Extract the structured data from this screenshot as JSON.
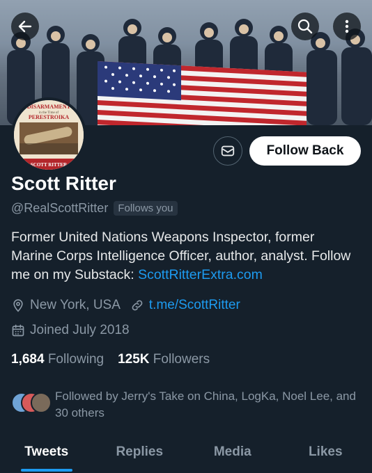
{
  "profile": {
    "name": "Scott Ritter",
    "handle": "@RealScottRitter",
    "follows_you": "Follows you",
    "bio_text": "Former United Nations Weapons Inspector, former Marine Corps Intelligence Officer, author, analyst. Follow me on my Substack: ",
    "bio_link": "ScottRitterExtra.com",
    "location": "New York, USA",
    "website": "t.me/ScottRitter",
    "joined": "Joined July 2018",
    "following_count": "1,684",
    "following_label": "Following",
    "followers_count": "125K",
    "followers_label": "Followers",
    "followed_by": "Followed by Jerry's Take on China, LogKa, Noel Lee, and 30 others"
  },
  "avatar_text": {
    "line1": "DISARMAMENT",
    "line2": "in the Time of",
    "line3": "PERESTROIKA",
    "line4": "SCOTT RITTER"
  },
  "actions": {
    "follow_button": "Follow Back"
  },
  "tabs": [
    {
      "label": "Tweets",
      "active": true
    },
    {
      "label": "Replies",
      "active": false
    },
    {
      "label": "Media",
      "active": false
    },
    {
      "label": "Likes",
      "active": false
    }
  ],
  "icons": {
    "back": "back-arrow-icon",
    "search": "search-icon",
    "more": "more-vertical-icon",
    "message": "message-icon",
    "location": "location-pin-icon",
    "link": "link-icon",
    "calendar": "calendar-icon"
  },
  "colors": {
    "background": "#15202b",
    "accent": "#1d9bf0",
    "secondary_text": "#8b98a5"
  }
}
